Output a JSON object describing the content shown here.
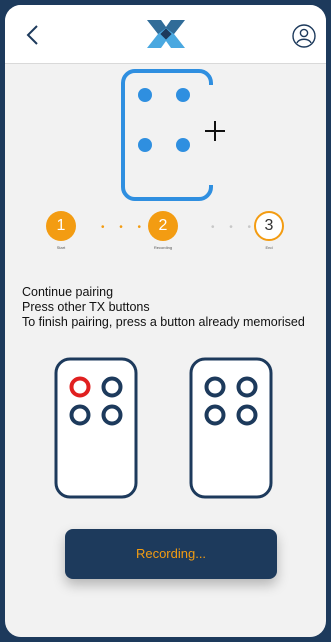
{
  "header": {
    "back_icon": "chevron-left-icon",
    "logo_icon": "brand-logo-icon",
    "user_icon": "user-profile-icon"
  },
  "steps": [
    {
      "number": "1",
      "label": "Start",
      "state": "done"
    },
    {
      "number": "2",
      "label": "Recording",
      "state": "active"
    },
    {
      "number": "3",
      "label": "End",
      "state": "pending"
    }
  ],
  "instructions": {
    "line1": "Continue pairing",
    "line2": "Press other TX buttons",
    "line3": "To finish pairing, press a button already memorised"
  },
  "remotes": [
    {
      "highlighted_button": "top-left"
    },
    {
      "highlighted_button": "none"
    }
  ],
  "colors": {
    "accent": "#f39c12",
    "navy": "#1d3a5c",
    "device_blue": "#2f8fe0",
    "highlight_red": "#e02020"
  },
  "action": {
    "recording_label": "Recording..."
  }
}
